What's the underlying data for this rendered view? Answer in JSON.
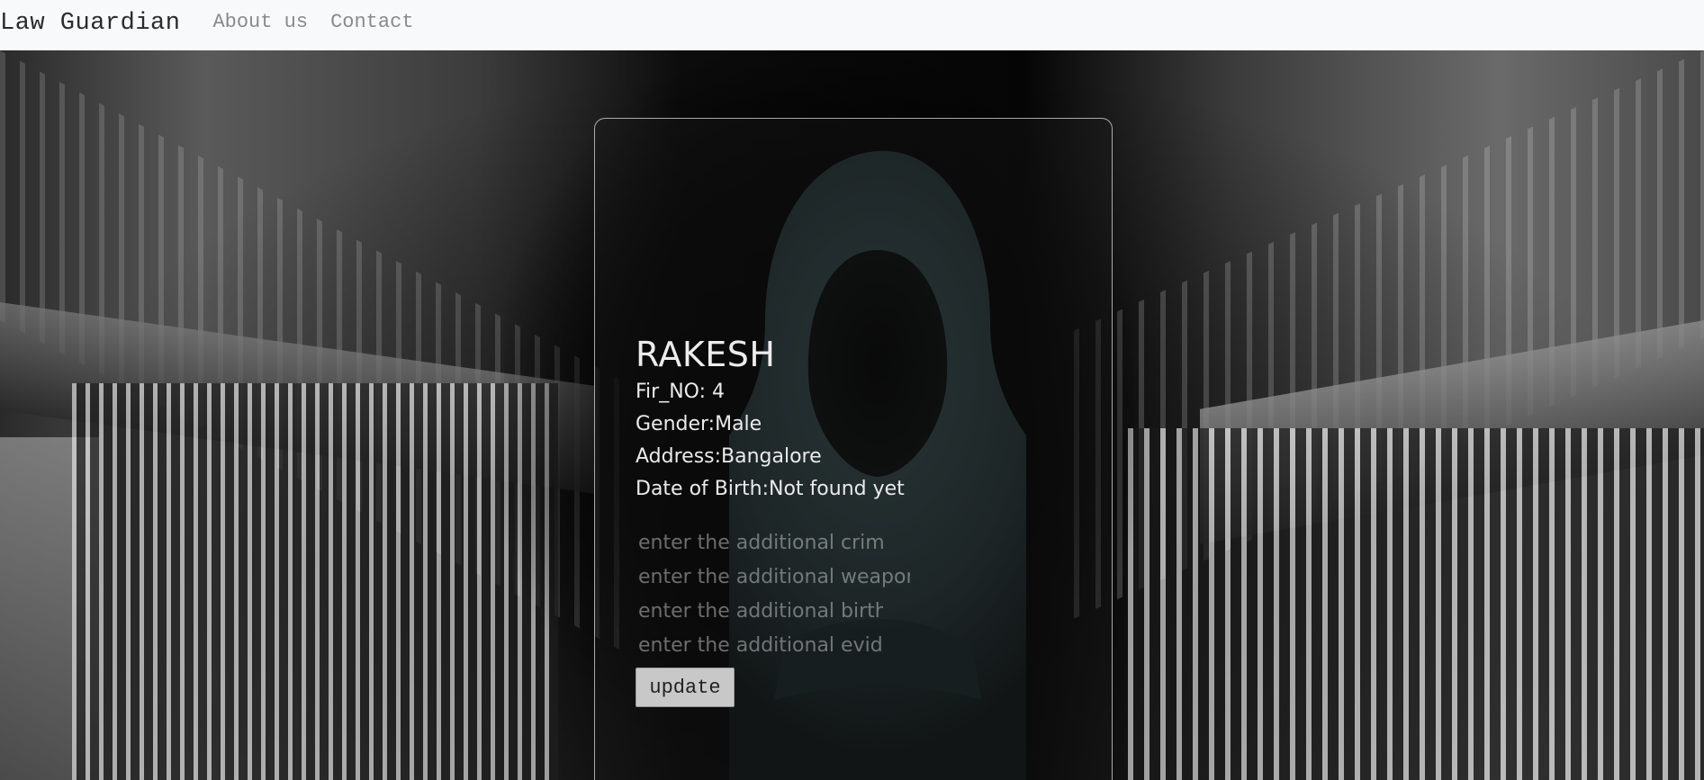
{
  "navbar": {
    "brand": "Law Guardian",
    "links": [
      {
        "label": "About us"
      },
      {
        "label": "Contact"
      }
    ]
  },
  "profile": {
    "name": "RAKESH",
    "fir_no": "Fir_NO: 4",
    "gender": "Gender:Male",
    "address": "Address:Bangalore",
    "dob": "Date of Birth:Not found yet"
  },
  "form": {
    "crimes_placeholder": "enter the additional crimes",
    "weapons_placeholder": "enter the additional weapons",
    "birthmarks_placeholder": "enter the additional birthmarks",
    "evidence_placeholder": "enter the additional evidence",
    "update_label": "update"
  },
  "colors": {
    "navbar_bg": "#f8f9fa",
    "card_border": "#dcdcdc",
    "button_bg": "#c8c8c8"
  }
}
